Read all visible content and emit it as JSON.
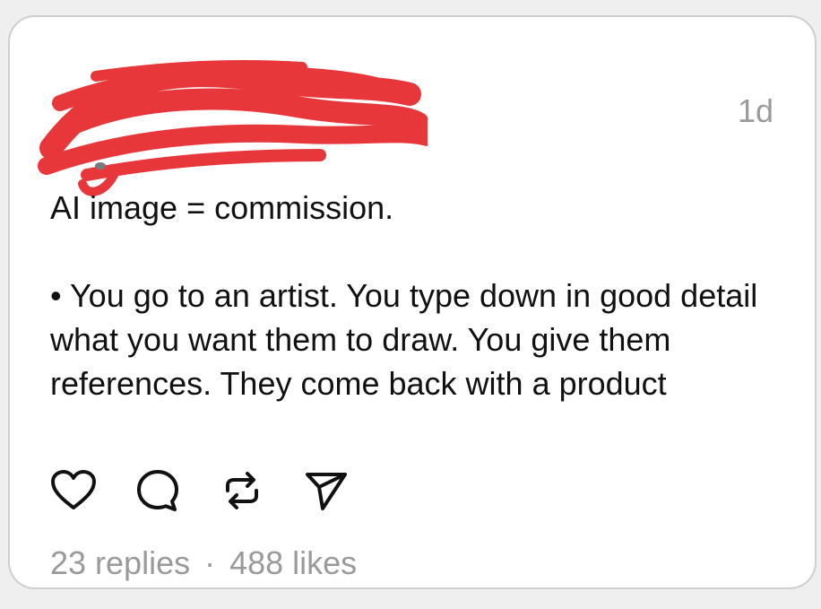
{
  "post": {
    "timestamp": "1d",
    "text": {
      "headline": "AI image = commission.",
      "bullet_symbol": "•",
      "bullet_text": "You go to an artist. You type down in good detail what you want them to draw. You give them references. They come back with a product"
    },
    "actions": {
      "icons": [
        "heart-icon",
        "comment-icon",
        "repost-icon",
        "share-icon"
      ]
    },
    "stats": {
      "replies": "23 replies",
      "separator": "·",
      "likes": "488 likes"
    },
    "colors": {
      "redaction": "#e8373b",
      "muted": "#9a9a9a",
      "text": "#111111"
    }
  }
}
